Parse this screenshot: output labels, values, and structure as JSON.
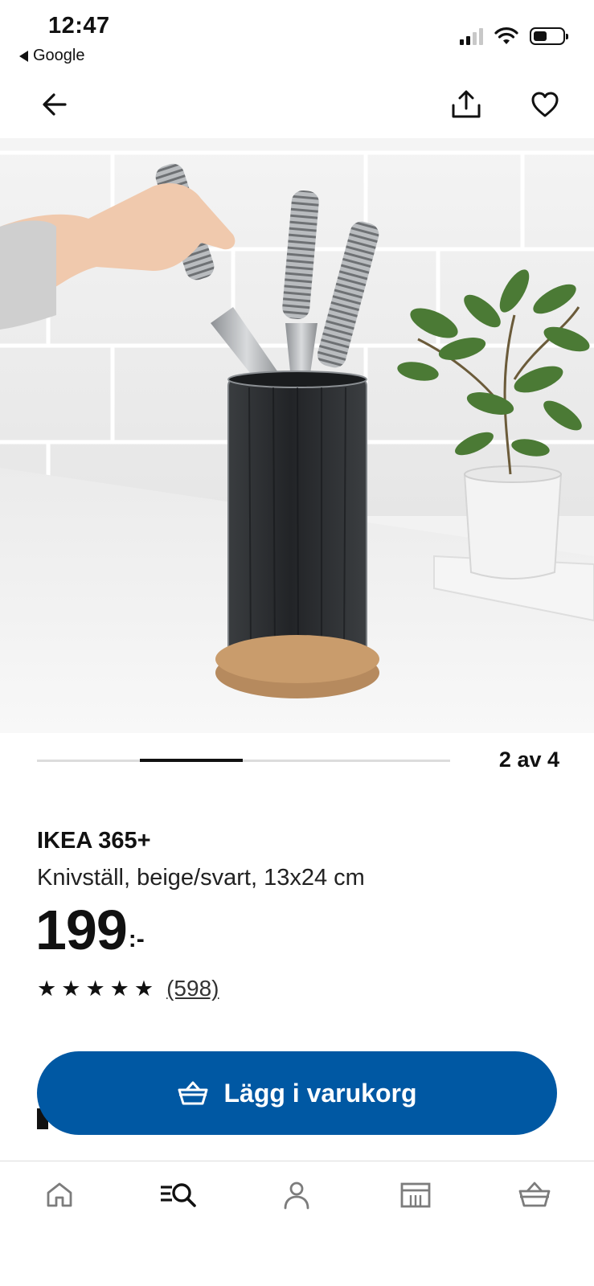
{
  "status_bar": {
    "time": "12:47",
    "back_app": "Google",
    "signal_bars_active": 2,
    "signal_bars_total": 4,
    "battery_level": 0.48
  },
  "top_nav": {
    "back_icon": "arrow-left-icon",
    "share_icon": "share-icon",
    "favorite_icon": "heart-icon"
  },
  "product_image": {
    "scene": "knife-block-with-knives-and-plant"
  },
  "carousel": {
    "counter": "2 av 4",
    "current": 2,
    "total": 4
  },
  "product": {
    "name": "IKEA 365+",
    "description": "Knivställ, beige/svart, 13x24 cm",
    "price_amount": "199",
    "price_suffix": ":-",
    "rating": 5,
    "rating_max": 5,
    "review_count": "(598)"
  },
  "cart_button": {
    "label": "Lägg i varukorg",
    "icon": "basket-icon",
    "color": "#0058a3"
  },
  "bottom_nav": {
    "tabs": [
      {
        "name": "home",
        "icon": "home-icon"
      },
      {
        "name": "search",
        "icon": "search-icon",
        "active": true
      },
      {
        "name": "profile",
        "icon": "person-icon"
      },
      {
        "name": "store",
        "icon": "store-icon"
      },
      {
        "name": "cart",
        "icon": "basket-icon"
      }
    ]
  }
}
